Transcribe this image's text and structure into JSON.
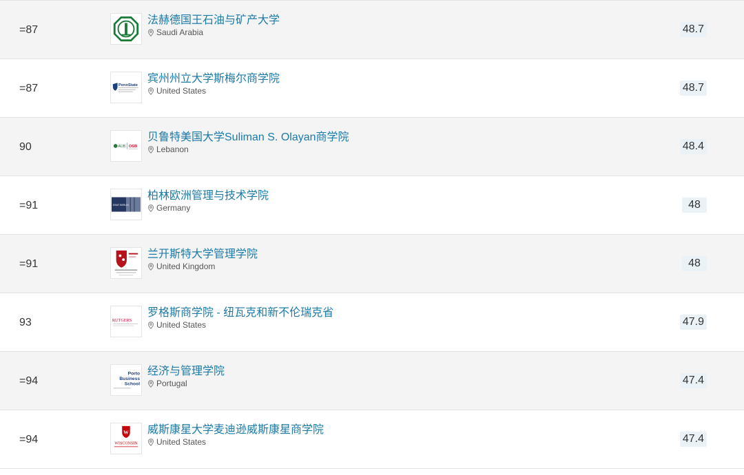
{
  "rows": [
    {
      "rank": "=87",
      "name": "法赫德国王石油与矿产大学",
      "location": "Saudi Arabia",
      "score": "48.7",
      "logo": "kfupm-logo"
    },
    {
      "rank": "=87",
      "name": "宾州州立大学斯梅尔商学院",
      "location": "United States",
      "score": "48.7",
      "logo": "pennstate-logo"
    },
    {
      "rank": "90",
      "name": "贝鲁特美国大学Suliman S. Olayan商学院",
      "location": "Lebanon",
      "score": "48.4",
      "logo": "aub-osb-logo"
    },
    {
      "rank": "=91",
      "name": "柏林欧洲管理与技术学院",
      "location": "Germany",
      "score": "48",
      "logo": "esmt-logo"
    },
    {
      "rank": "=91",
      "name": "兰开斯特大学管理学院",
      "location": "United Kingdom",
      "score": "48",
      "logo": "lancaster-logo"
    },
    {
      "rank": "93",
      "name": "罗格斯商学院 - 纽瓦克和新不伦瑞克省",
      "location": "United States",
      "score": "47.9",
      "logo": "rutgers-logo"
    },
    {
      "rank": "=94",
      "name": "经济与管理学院",
      "location": "Portugal",
      "score": "47.4",
      "logo": "porto-logo"
    },
    {
      "rank": "=94",
      "name": "威斯康星大学麦迪逊威斯康星商学院",
      "location": "United States",
      "score": "47.4",
      "logo": "wisconsin-logo"
    }
  ],
  "logo_text": {
    "pennstate": "PennState",
    "aub": "AUB",
    "osb": "OSB",
    "esmt": "ESMT BERLIN",
    "rutgers": "RUTGERS",
    "porto": [
      "Porto",
      "Business",
      "School"
    ],
    "wisconsin": "WISCONSIN"
  },
  "colors": {
    "link": "#1c7aa8",
    "score_bg": "#eaf1f7",
    "row_shade": "#f4f4f4"
  },
  "icons": {
    "location": "location-pin-icon"
  }
}
